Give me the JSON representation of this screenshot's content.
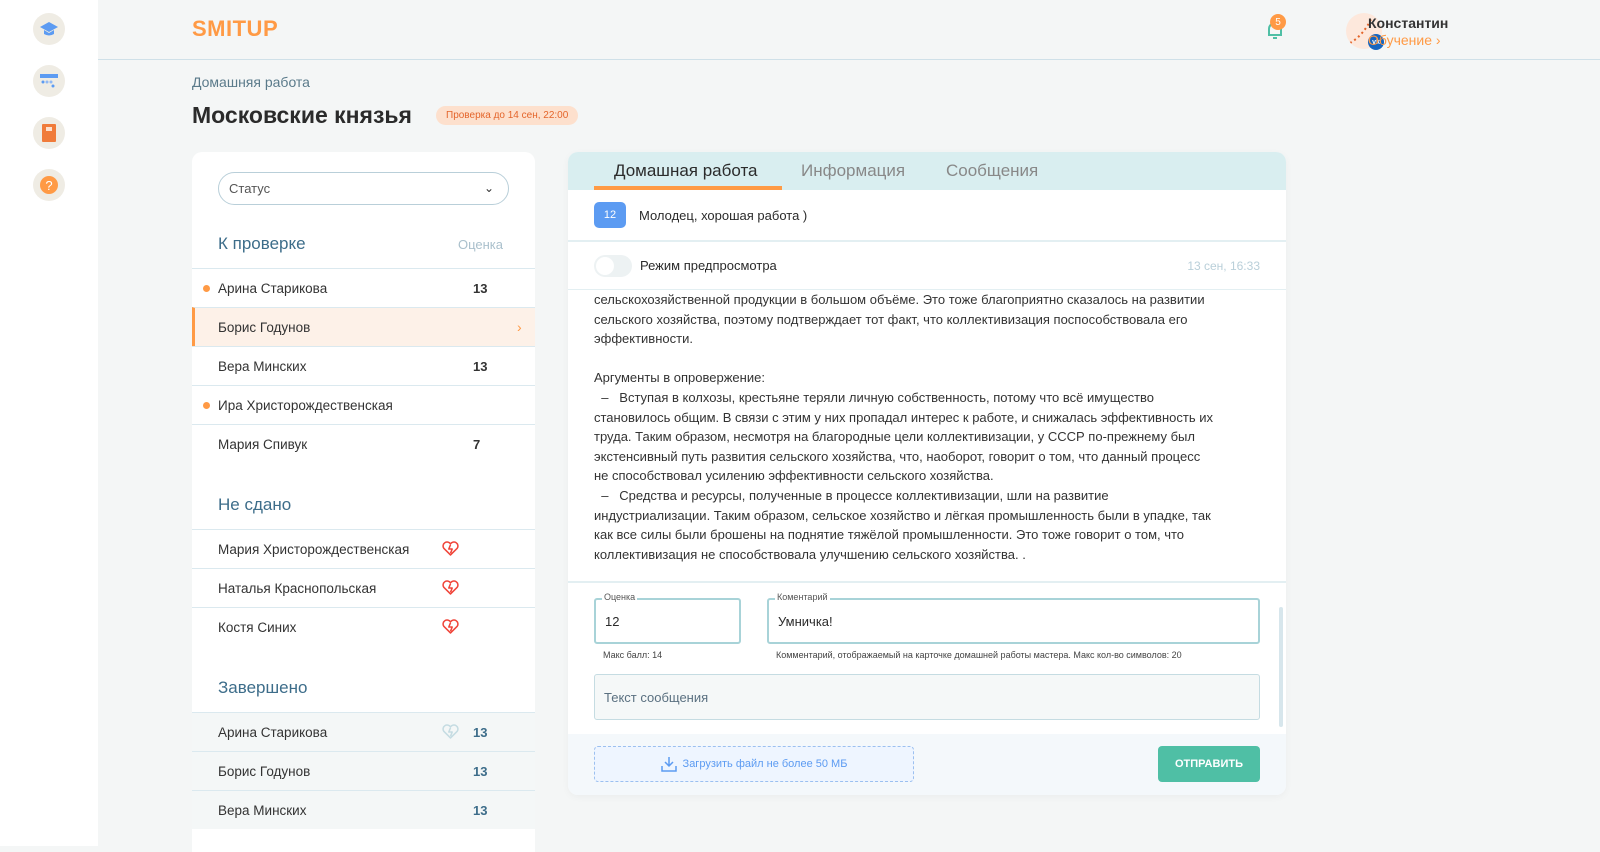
{
  "header": {
    "logo": "SMITUP",
    "notifications_count": "5",
    "user_name": "Константин",
    "user_link": "Обучение ›"
  },
  "sidebar": {
    "icons": [
      "graduation-cap-icon",
      "calendar-icon",
      "book-icon",
      "help-icon"
    ]
  },
  "breadcrumb": "Домашняя работа",
  "page_title": "Московские князья",
  "deadline_badge": "Проверка до 14 сен, 22:00",
  "left_panel": {
    "status_select": "Статус",
    "sections": [
      {
        "title": "К проверке",
        "col": "Оценка",
        "rows": [
          {
            "name": "Арина Старикова",
            "score": "13",
            "dot": true
          },
          {
            "name": "Борис Годунов",
            "score": "",
            "active": true
          },
          {
            "name": "Вера Минских",
            "score": "13"
          },
          {
            "name": "Ира Христорождественская",
            "score": "",
            "dot": true
          },
          {
            "name": "Мария Спивук",
            "score": "7"
          }
        ]
      },
      {
        "title": "Не сдано",
        "rows": [
          {
            "name": "Мария Христорождественская"
          },
          {
            "name": "Наталья Краснопольская"
          },
          {
            "name": "Костя Синих"
          }
        ]
      },
      {
        "title": "Завершено",
        "rows": [
          {
            "name": "Арина Старикова",
            "score": "13"
          },
          {
            "name": "Борис Годунов",
            "score": "13"
          },
          {
            "name": "Вера Минских",
            "score": "13"
          }
        ]
      }
    ]
  },
  "main": {
    "tabs": [
      "Домашная работа",
      "Информация",
      "Сообщения"
    ],
    "grade": "12",
    "grade_comment": "Молодец, хорошая работа )",
    "preview_label": "Режим предпросмотра",
    "timestamp": "13 сен, 16:33",
    "text_lines": [
      "сельскохозяйственной продукции в большом объёме. Это тоже благоприятно сказалось на развитии",
      "сельского хозяйства, поэтому подтверждает тот факт, что коллективизация поспособствовала его",
      "эффективности.",
      "",
      "Аргументы в опровержение:",
      "  –   Вступая в колхозы, крестьяне теряли личную собственность, потому что всё имущество",
      "становилось общим. В связи с этим у них пропадал интерес к работе, и снижалась эффективность их",
      "труда. Таким образом, несмотря на благородные цели коллективизации, у СССР по-прежнему был",
      "экстенсивный путь развития сельского хозяйства, что, наоборот, говорит о том, что данный процесс",
      "не способствовал усилению эффективности сельского хозяйства.",
      "  –   Средства и ресурсы, полученные в процессе коллективизации, шли на развитие",
      "индустриализации. Таким образом, сельское хозяйство и лёгкая промышленность были в упадке, так",
      "как все силы были брошены на поднятие тяжёлой промышленности. Это тоже говорит о том, что",
      "коллективизация не способствовала улучшению сельского хозяйства. ."
    ],
    "score_label": "Оценка",
    "score_value": "12",
    "score_hint": "Макс балл: 14",
    "comment_label": "Коментарий",
    "comment_value": "Умничка!",
    "comment_hint": "Комментарий, отображаемый на карточке домашней работы мастера. Макс кол-во символов: 20",
    "message_placeholder": "Текст сообщения",
    "upload_label": "Загрузить файл не более 50 МБ",
    "send_label": "ОТПРАВИТЬ"
  },
  "colors": {
    "accent": "#ff9a45",
    "teal": "#4fbfa5",
    "blue": "#5c9bf2",
    "heading": "#3d6d8a"
  }
}
